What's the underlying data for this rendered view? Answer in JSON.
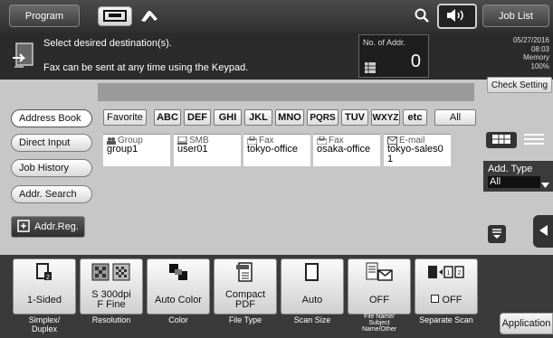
{
  "topbar": {
    "program_label": "Program",
    "job_list_label": "Job List"
  },
  "message": {
    "line1": "Select desired destination(s).",
    "line2": "Fax can be sent at any time using the Keypad."
  },
  "addr_count": {
    "label": "No. of Addr.",
    "value": "0"
  },
  "status": {
    "date": "05/27/2016",
    "time": "08:03",
    "memory_label": "Memory",
    "memory_value": "100%"
  },
  "check_setting_label": "Check Setting",
  "index_tabs": [
    "Favorite",
    "ABC",
    "DEF",
    "GHI",
    "JKL",
    "MNO",
    "PQRS",
    "TUV",
    "WXYZ",
    "etc",
    "All"
  ],
  "sidebar": {
    "items": [
      "Address Book",
      "Direct Input",
      "Job History",
      "Addr. Search"
    ],
    "addr_reg_label": "Addr.Reg."
  },
  "destinations": [
    {
      "type": "Group",
      "name": "group1",
      "icon": "group-icon"
    },
    {
      "type": "SMB",
      "name": "user01",
      "icon": "computer-icon"
    },
    {
      "type": "Fax",
      "name": "tokyo-office",
      "icon": "fax-icon"
    },
    {
      "type": "Fax",
      "name": "osaka-office",
      "icon": "fax-icon"
    },
    {
      "type": "E-mail",
      "name": "tokyo-sales0\n1",
      "icon": "envelope-icon"
    }
  ],
  "add_type": {
    "label": "Add. Type",
    "value": "All"
  },
  "function_keys": [
    {
      "value": "1-Sided",
      "label": "Simplex/\nDuplex"
    },
    {
      "value": "S 300dpi\nF Fine",
      "label": "Resolution"
    },
    {
      "value": "Auto Color",
      "label": "Color"
    },
    {
      "value": "Compact\nPDF",
      "label": "File Type"
    },
    {
      "value": "Auto",
      "label": "Scan Size"
    },
    {
      "value": "OFF",
      "label": "File Name/\nSubject\nName/Other"
    },
    {
      "value": "OFF",
      "label": "Separate Scan"
    }
  ],
  "application_label": "Application"
}
